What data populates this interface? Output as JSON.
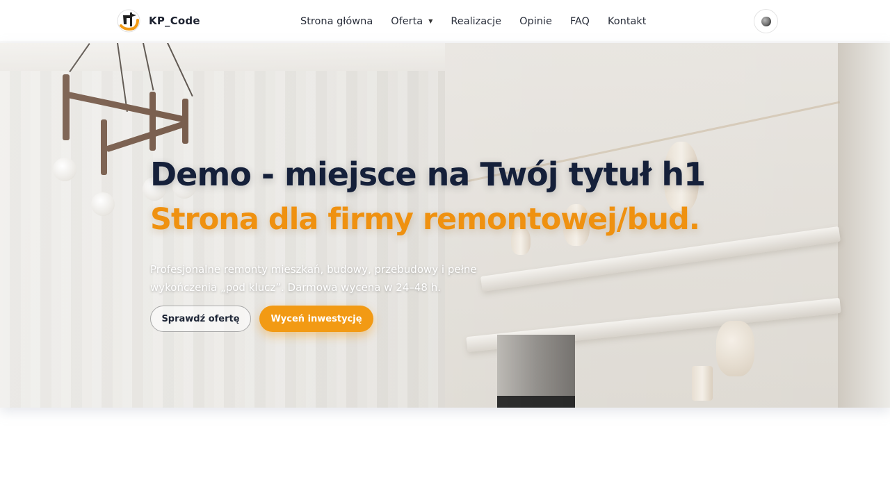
{
  "header": {
    "brand": "KP_Code",
    "nav": [
      {
        "label": "Strona główna"
      },
      {
        "label": "Oferta",
        "has_dropdown": true
      },
      {
        "label": "Realizacje"
      },
      {
        "label": "Opinie"
      },
      {
        "label": "FAQ"
      },
      {
        "label": "Kontakt"
      }
    ],
    "theme_toggle_icon": "moon-icon"
  },
  "hero": {
    "title": "Demo - miejsce na Twój tytuł h1",
    "subtitle": "Strona dla firmy remontowej/bud.",
    "description": "Profesjonalne remonty mieszkań, budowy, przebudowy i pełne wykończenia „pod klucz”. Darmowa wycena w 24–48 h.",
    "btn_secondary": "Sprawdź ofertę",
    "btn_primary": "Wyceń inwestycję"
  },
  "colors": {
    "accent": "#f29a14",
    "title": "#15203a",
    "subtitle": "#ef9110"
  }
}
